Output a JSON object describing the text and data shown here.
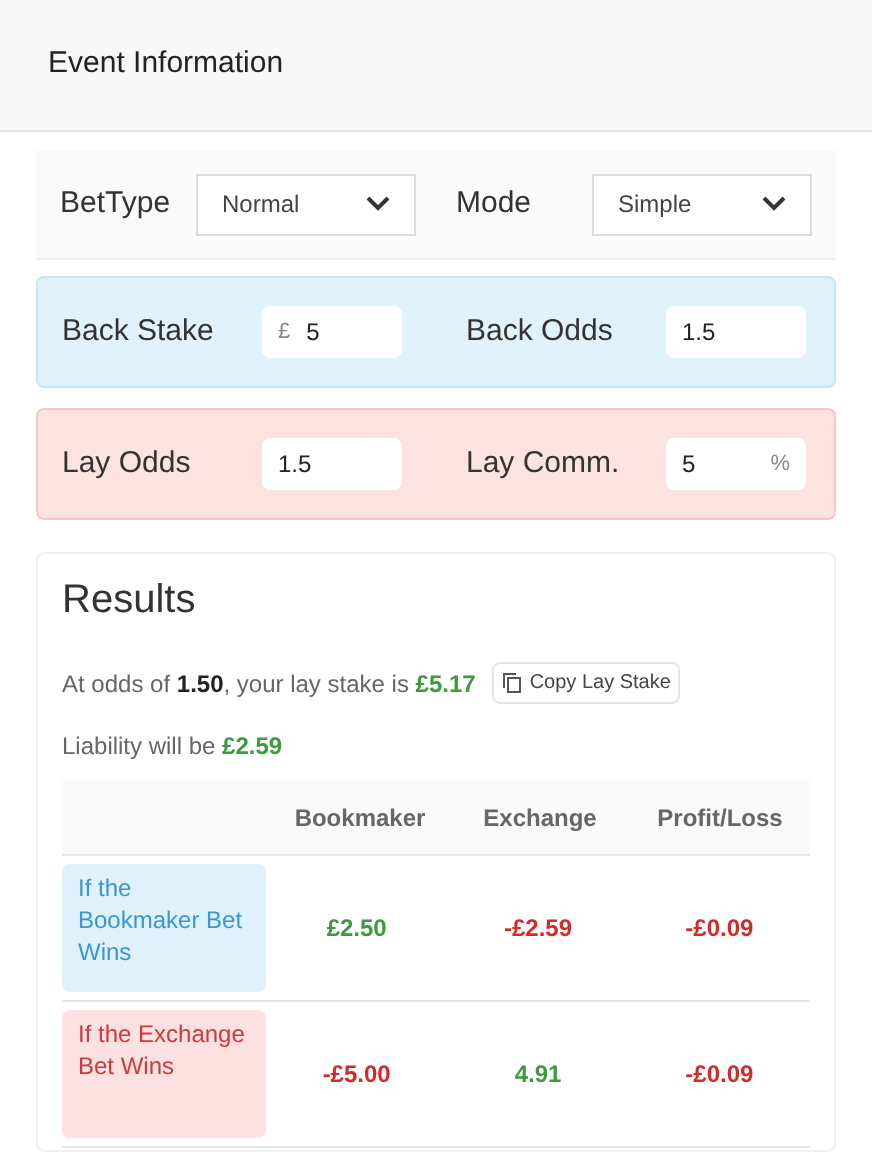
{
  "header": {
    "title": "Event Information"
  },
  "settings": [
    {
      "label": "BetType",
      "value": "Normal"
    },
    {
      "label": "Mode",
      "value": "Simple"
    }
  ],
  "back": {
    "kind": "back",
    "fields": [
      {
        "label": "Back Stake",
        "prefix": "£",
        "value": "5"
      },
      {
        "label": "Back Odds",
        "value": "1.5"
      }
    ]
  },
  "lay": {
    "kind": "lay",
    "fields": [
      {
        "label": "Lay Odds",
        "value": "1.5"
      },
      {
        "label": "Lay Comm.",
        "value": "5",
        "suffix": "%"
      }
    ]
  },
  "results": {
    "title": "Results",
    "summary": {
      "lead": "At odds of",
      "odds": "1.50",
      "middle": ", your lay stake is",
      "stake": "£5.17"
    },
    "copy_button": "Copy Lay Stake",
    "liability": {
      "lead": "Liability will be",
      "amount": "£2.59"
    },
    "table": {
      "columns": [
        "Bookmaker",
        "Exchange",
        "Profit/Loss"
      ],
      "rows": [
        {
          "kind": "back",
          "label": "If the Bookmaker Bet Wins",
          "cells": [
            {
              "text": "£2.50",
              "kind": "positive"
            },
            {
              "text": "-£2.59",
              "kind": "negative"
            },
            {
              "text": "-£0.09",
              "kind": "negative"
            }
          ]
        },
        {
          "kind": "lay",
          "label": "If the Exchange Bet Wins",
          "cells": [
            {
              "text": "-£5.00",
              "kind": "negative"
            },
            {
              "text": "4.91",
              "kind": "positive"
            },
            {
              "text": "-£0.09",
              "kind": "negative"
            }
          ]
        }
      ]
    }
  }
}
